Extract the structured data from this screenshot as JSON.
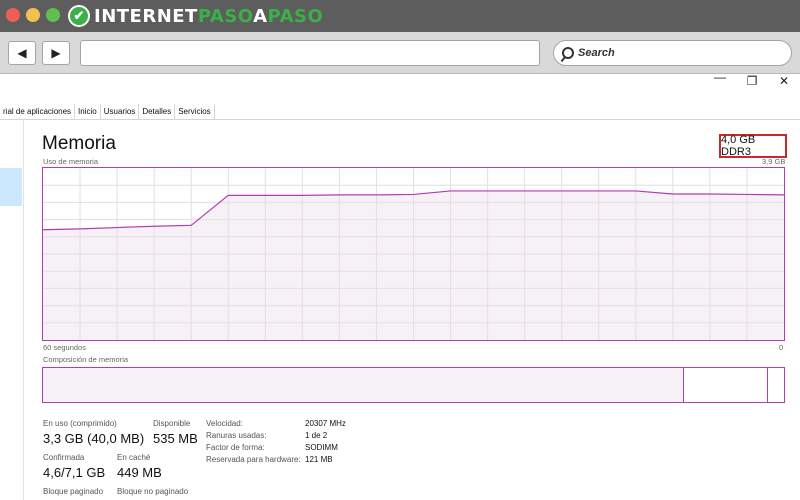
{
  "site": {
    "logo_mark": "✔",
    "logo_part1": "INTERNET",
    "logo_part2": "PASO",
    "logo_part3": "A",
    "logo_part4": "PASO",
    "search_placeholder": "Search",
    "back_glyph": "◀",
    "forward_glyph": "▶"
  },
  "window_controls": {
    "minimize": "—",
    "maximize": "❐",
    "close": "✕"
  },
  "tabs": [
    "rial de aplicaciones",
    "Inicio",
    "Usuarios",
    "Detalles",
    "Servicios"
  ],
  "memory": {
    "title": "Memoria",
    "type_badge": "4,0 GB DDR3",
    "usage_label": "Uso de memoria",
    "max_label": "3,9 GB",
    "time_label": "60 segundos",
    "zero_label": "0",
    "composition_label": "Composición de memoria"
  },
  "stats": {
    "in_use_label": "En uso (comprimido)",
    "in_use_value": "3,3 GB (40,0 MB)",
    "available_label": "Disponible",
    "available_value": "535 MB",
    "committed_label": "Confirmada",
    "committed_value": "4,6/7,1 GB",
    "cached_label": "En caché",
    "cached_value": "449 MB",
    "paged_label": "Bloque paginado",
    "nonpaged_label": "Bloque no paginado"
  },
  "details": {
    "speed_label": "Velocidad:",
    "speed_value": "20307 MHz",
    "slots_label": "Ranuras usadas:",
    "slots_value": "1 de 2",
    "form_label": "Factor de forma:",
    "form_value": "SODIMM",
    "reserved_label": "Reservada para hardware:",
    "reserved_value": "121 MB"
  },
  "chart_data": {
    "type": "area",
    "xlabel": "60 segundos",
    "ylabel": "Uso de memoria",
    "ylim": [
      0,
      3.9
    ],
    "x": [
      60,
      57,
      54,
      51,
      48,
      45,
      42,
      39,
      36,
      33,
      30,
      27,
      24,
      21,
      18,
      15,
      12,
      9,
      6,
      3,
      0
    ],
    "values": [
      2.5,
      2.52,
      2.55,
      2.58,
      2.6,
      3.28,
      3.28,
      3.28,
      3.29,
      3.29,
      3.3,
      3.38,
      3.38,
      3.38,
      3.38,
      3.38,
      3.38,
      3.31,
      3.31,
      3.3,
      3.29
    ],
    "grid": true,
    "colors": {
      "line": "#b23bb4",
      "fill": "#f4eff4",
      "grid": "#e6dce6"
    }
  }
}
